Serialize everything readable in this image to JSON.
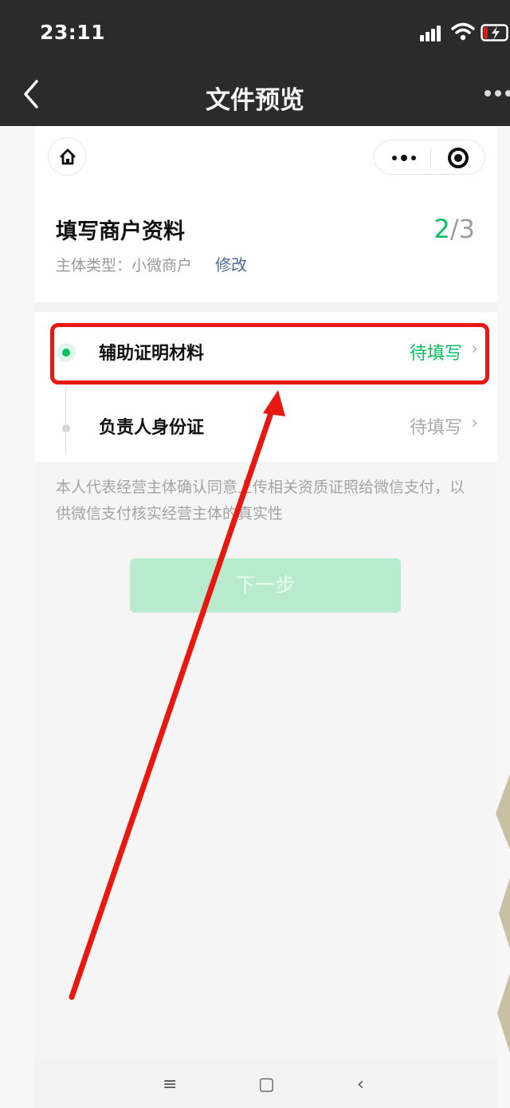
{
  "status_bar": {
    "time": "23:11"
  },
  "nav": {
    "title": "文件预览",
    "back_icon": "chevron-left-icon",
    "more_icon": "more-dots-icon"
  },
  "capsule": {
    "home_icon": "home-icon",
    "menu_icon": "more-dots-icon",
    "close_icon": "record-circle-icon"
  },
  "form": {
    "title": "填写商户资料",
    "step_current": "2",
    "step_rest": "/3",
    "subject_label": "主体类型：小微商户",
    "edit_label": "修改"
  },
  "items": [
    {
      "label": "辅助证明材料",
      "status": "待填写",
      "chevron": "›"
    },
    {
      "label": "负责人身份证",
      "status": "待填写",
      "chevron": "›"
    }
  ],
  "agreement_text": "本人代表经营主体确认同意上传相关资质证照给微信支付，以供微信支付核实经营主体的真实性",
  "next_button": "下一步",
  "system_nav": {
    "menu": "≡",
    "home": "▢",
    "back": "‹"
  },
  "colors": {
    "accent": "#07c160",
    "annotation": "#e8170f",
    "link": "#4f6b97"
  }
}
